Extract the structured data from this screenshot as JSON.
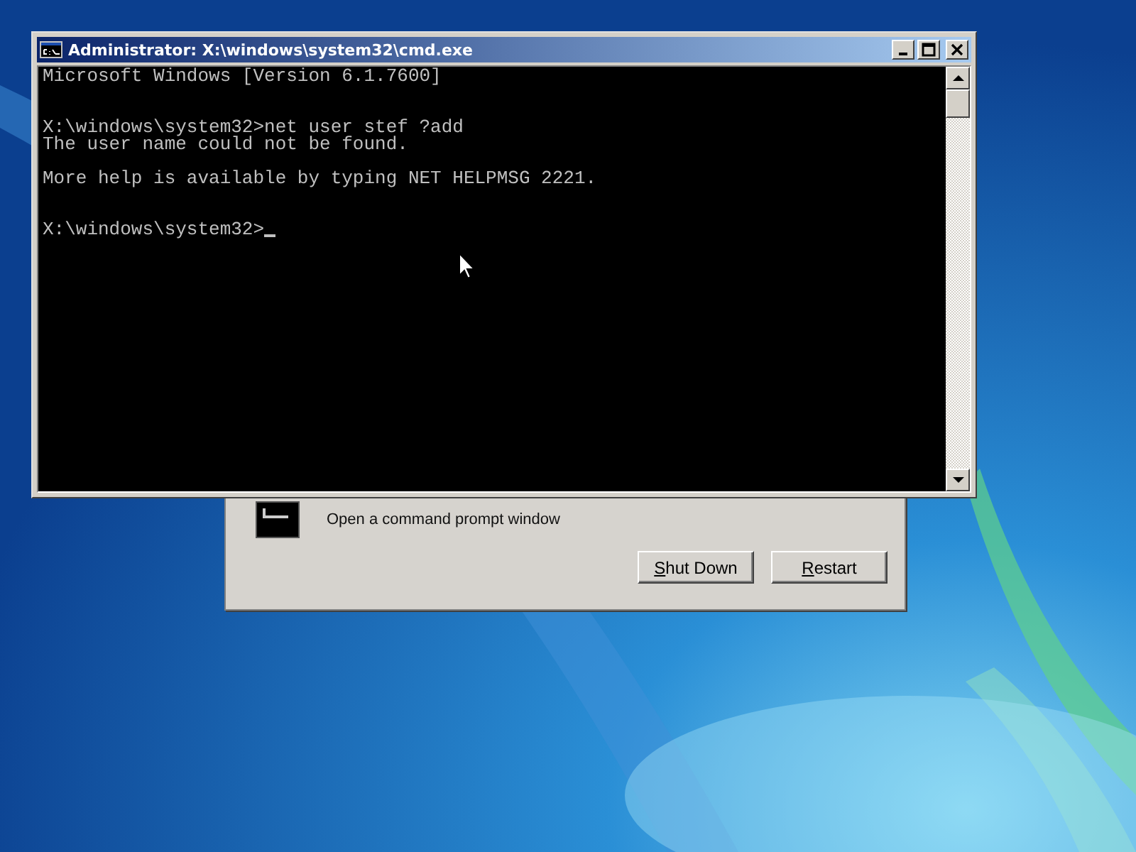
{
  "background_dialog": {
    "description": "Open a command prompt window",
    "buttons": [
      "Shut Down",
      "Restart"
    ]
  },
  "console_window": {
    "title": "Administrator: X:\\windows\\system32\\cmd.exe",
    "blocks": [
      [
        "Microsoft Windows [Version 6.1.7600]"
      ],
      [
        "X:\\windows\\system32>net user stef ?add",
        "The user name could not be found."
      ],
      [
        "More help is available by typing NET HELPMSG 2221."
      ],
      [
        "X:\\windows\\system32>"
      ]
    ],
    "cursor": true
  }
}
